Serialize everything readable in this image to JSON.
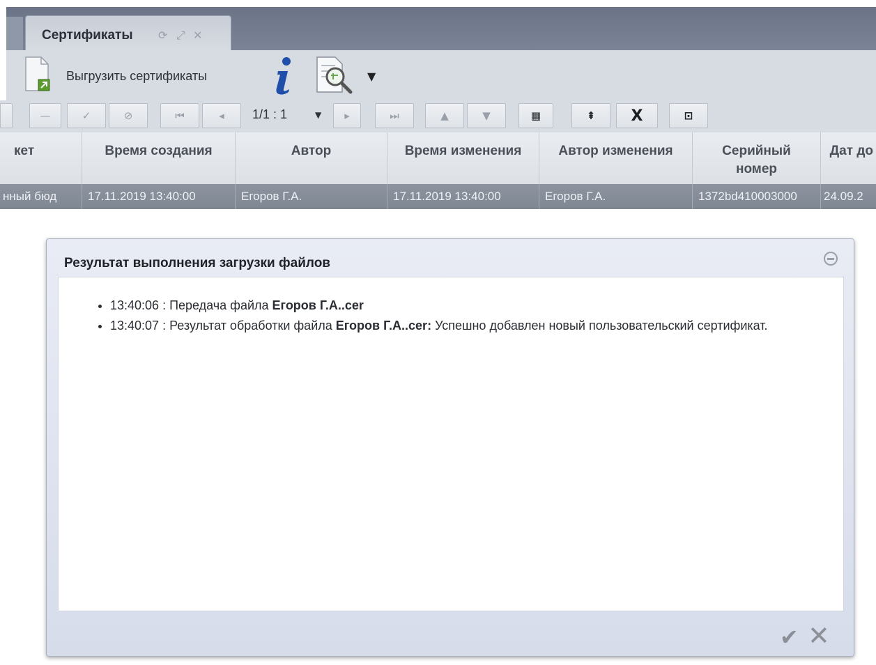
{
  "tab": {
    "title": "Сертификаты"
  },
  "toolbar": {
    "export_label": "Выгрузить сертификаты",
    "pager": "1/1 : 1"
  },
  "grid": {
    "columns": [
      "кет",
      "Время создания",
      "Автор",
      "Время изменения",
      "Автор изменения",
      "Серийный номер",
      "Дат до"
    ],
    "row": [
      "нный бюд",
      "17.11.2019 13:40:00",
      "Егоров Г.А.",
      "17.11.2019 13:40:00",
      "Егоров Г.А.",
      "1372bd410003000",
      "24.09.2"
    ]
  },
  "modal": {
    "title": "Результат выполнения загрузки файлов",
    "log": [
      {
        "prefix": "13:40:06 : Передача файла ",
        "file": "Егоров Г.А..cer",
        "suffix": ""
      },
      {
        "prefix": "13:40:07 : Результат обработки файла ",
        "file": "Егоров Г.А..cer:",
        "suffix": " Успешно добавлен новый пользовательский сертификат."
      }
    ]
  },
  "icons": {
    "tab": [
      "refresh-icon",
      "expand-icon",
      "close-icon"
    ],
    "toolbar1": [
      "export-icon",
      "info-icon",
      "search-document-icon",
      "dropdown-arrow-icon"
    ],
    "modal": [
      "collapse-icon",
      "ok-icon",
      "cancel-icon"
    ]
  },
  "colors": {
    "tab_strip": "#6b7486",
    "toolbar": "#d7dbe2",
    "selected_row": "#8d94a0",
    "info_blue": "#1f4fa8"
  }
}
